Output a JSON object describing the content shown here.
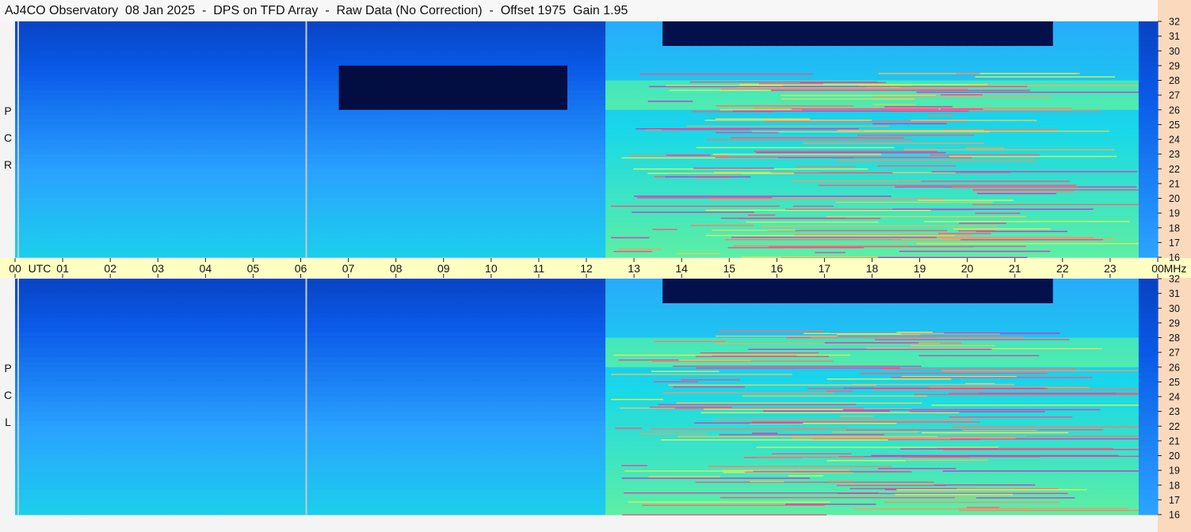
{
  "title": "AJ4CO Observatory  08 Jan 2025  -  DPS on TFD Array  -  Raw Data (No Correction)  -  Offset 1975  Gain 1.95",
  "colors": {
    "frame_bg": "#f4f4f4",
    "axis_strip": "#fbd9bd",
    "time_band": "#ffffc4",
    "colormap": [
      "#000018",
      "#062a9a",
      "#0a5ae8",
      "#2aa2ff",
      "#18d8e8",
      "#60f0a0",
      "#d8f850",
      "#ff5a78",
      "#c030e0"
    ]
  },
  "chart_data": [
    {
      "type": "heatmap",
      "panel": "RCP",
      "label_letters": [
        "P",
        "C",
        "R"
      ],
      "x": {
        "label": "UTC",
        "ticks": [
          "00",
          "01",
          "02",
          "03",
          "04",
          "05",
          "06",
          "07",
          "08",
          "09",
          "10",
          "11",
          "12",
          "13",
          "14",
          "15",
          "16",
          "17",
          "18",
          "19",
          "20",
          "21",
          "22",
          "23",
          "00"
        ],
        "range_hours": [
          0,
          24
        ]
      },
      "y": {
        "label": "MHz",
        "ticks": [
          32,
          31,
          30,
          29,
          28,
          27,
          26,
          25,
          24,
          23,
          22,
          21,
          20,
          19,
          18,
          17,
          16
        ],
        "range_mhz": [
          16,
          32
        ]
      },
      "features": {
        "dark_absorption_band_hours": [
          6.8,
          11.6
        ],
        "dark_absorption_band_mhz": [
          26,
          29
        ],
        "intense_activity_hours": [
          12.5,
          23.6
        ],
        "high_freq_dark_region_hours": [
          13.7,
          21.8
        ],
        "high_freq_dark_region_mhz": [
          30.5,
          32
        ],
        "vertical_markers_hours": [
          0.05,
          6.1
        ]
      }
    },
    {
      "type": "heatmap",
      "panel": "LCP",
      "label_letters": [
        "P",
        "C",
        "L"
      ],
      "x": {
        "label": "UTC",
        "ticks": [
          "00",
          "01",
          "02",
          "03",
          "04",
          "05",
          "06",
          "07",
          "08",
          "09",
          "10",
          "11",
          "12",
          "13",
          "14",
          "15",
          "16",
          "17",
          "18",
          "19",
          "20",
          "21",
          "22",
          "23",
          "00"
        ],
        "range_hours": [
          0,
          24
        ]
      },
      "y": {
        "label": "MHz",
        "ticks": [
          32,
          31,
          30,
          29,
          28,
          27,
          26,
          25,
          24,
          23,
          22,
          21,
          20,
          19,
          18,
          17,
          16
        ],
        "range_mhz": [
          16,
          32
        ]
      },
      "features": {
        "intense_activity_hours": [
          12.5,
          23.6
        ],
        "high_freq_dark_region_hours": [
          13.7,
          21.8
        ],
        "high_freq_dark_region_mhz": [
          30.5,
          32
        ],
        "vertical_markers_hours": [
          0.05,
          6.1
        ]
      }
    }
  ],
  "time_axis": {
    "utc_label": "UTC",
    "mhz_label": "MHz",
    "hours": [
      "00",
      "01",
      "02",
      "03",
      "04",
      "05",
      "06",
      "07",
      "08",
      "09",
      "10",
      "11",
      "12",
      "13",
      "14",
      "15",
      "16",
      "17",
      "18",
      "19",
      "20",
      "21",
      "22",
      "23",
      "00"
    ]
  }
}
